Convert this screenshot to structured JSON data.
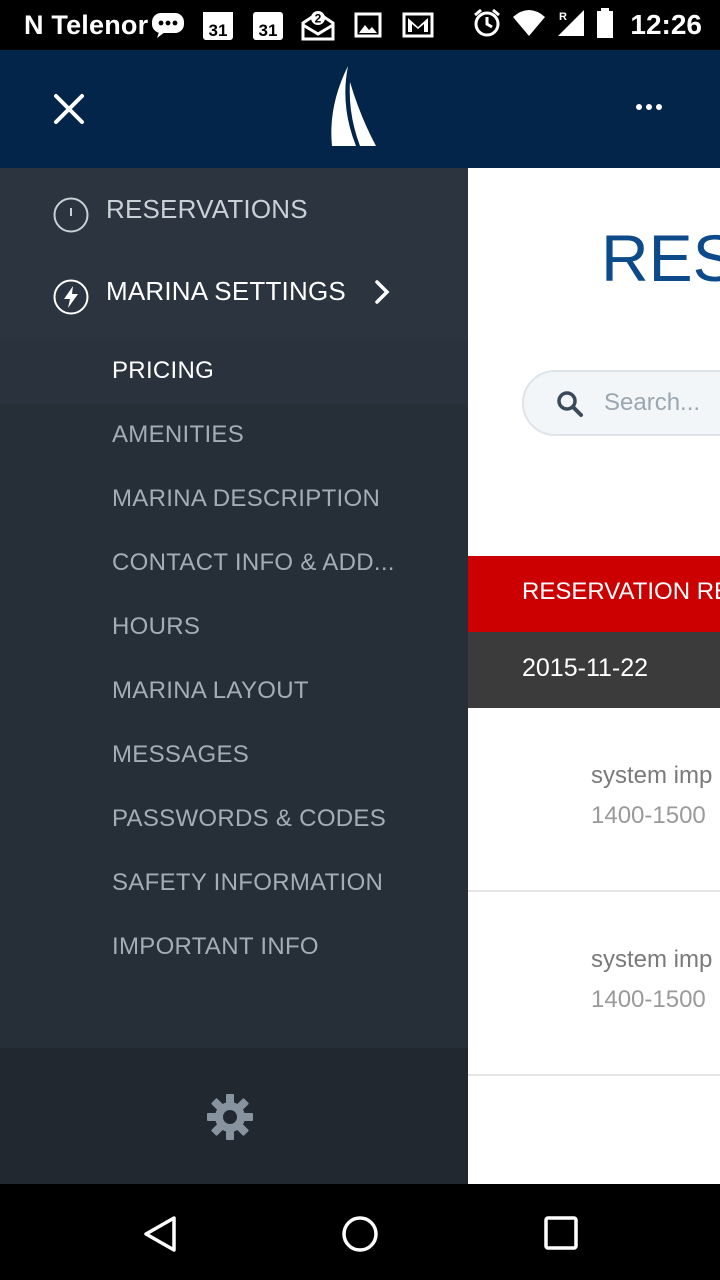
{
  "status_bar": {
    "carrier": "N Telenor",
    "calendar_day_1": "31",
    "calendar_day_2": "31",
    "mail_count": "2",
    "time": "12:26",
    "icons": [
      "message-icon",
      "calendar-icon",
      "calendar-icon",
      "mail-icon",
      "image-icon",
      "gmail-icon",
      "alarm-icon",
      "wifi-icon",
      "signal-icon",
      "battery-icon"
    ]
  },
  "app_bar": {
    "close_icon": "close-icon",
    "logo_icon": "sail-logo-icon",
    "more_icon": "more-dots-icon"
  },
  "drawer": {
    "items": [
      {
        "label": "RESERVATIONS",
        "icon": "clock-icon"
      },
      {
        "label": "MARINA SETTINGS",
        "icon": "lightning-icon",
        "chevron": "chevron-right-icon"
      }
    ],
    "submenu": [
      {
        "label": "PRICING",
        "active": true
      },
      {
        "label": "AMENITIES"
      },
      {
        "label": "MARINA DESCRIPTION"
      },
      {
        "label": "CONTACT INFO & ADD..."
      },
      {
        "label": "HOURS"
      },
      {
        "label": "MARINA LAYOUT"
      },
      {
        "label": "MESSAGES"
      },
      {
        "label": "PASSWORDS & CODES"
      },
      {
        "label": "SAFETY INFORMATION"
      },
      {
        "label": "IMPORTANT INFO"
      }
    ],
    "footer_icon": "gear-icon"
  },
  "content": {
    "page_title": "RESE",
    "search_placeholder": "Search...",
    "banner_label": "RESERVATION RE",
    "date": "2015-11-22",
    "entries": [
      {
        "line1": "system imp",
        "line2": "1400-1500"
      },
      {
        "line1": "system imp",
        "line2": "1400-1500"
      }
    ]
  },
  "colors": {
    "header_bg": "#04254a",
    "drawer_bg": "#2b343f",
    "accent_red": "#cc0000",
    "title_blue": "#0d4a8a"
  }
}
